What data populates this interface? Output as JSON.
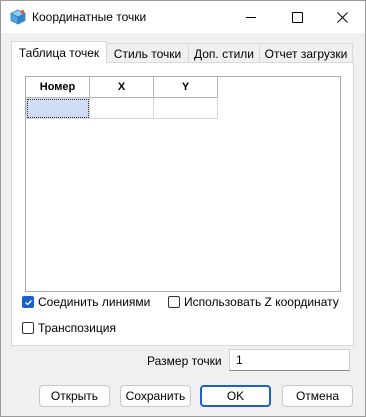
{
  "window": {
    "title": "Координатные точки"
  },
  "tabs": [
    {
      "label": "Таблица точек",
      "active": true
    },
    {
      "label": "Стиль точки",
      "active": false
    },
    {
      "label": "Доп. стили",
      "active": false
    },
    {
      "label": "Отчет загрузки",
      "active": false
    }
  ],
  "table": {
    "columns": [
      "Номер",
      "X",
      "Y"
    ],
    "rows": [
      [
        "",
        "",
        ""
      ]
    ]
  },
  "options": {
    "connect_lines": {
      "label": "Соединить линиями",
      "checked": true
    },
    "use_z": {
      "label": "Использовать Z координату",
      "checked": false
    },
    "transpose": {
      "label": "Транспозиция",
      "checked": false
    }
  },
  "point_size": {
    "label": "Размер точки",
    "value": "1"
  },
  "buttons": {
    "open": "Открыть",
    "save": "Сохранить",
    "ok": "OK",
    "cancel": "Отмена"
  },
  "colors": {
    "accent": "#1a62c9",
    "selection": "#cfdcf2"
  },
  "icons": [
    "app-cube-icon",
    "minimize-icon",
    "maximize-icon",
    "close-icon",
    "checkmark-icon"
  ]
}
